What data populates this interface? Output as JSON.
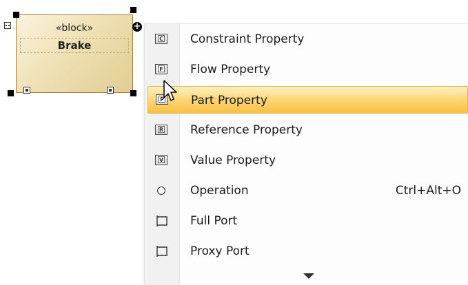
{
  "block": {
    "stereotype": "«block»",
    "name": "Brake"
  },
  "menu": {
    "items": [
      {
        "label": "Constraint Property",
        "icon": "constraint-property-icon",
        "icon_letter": "C",
        "shortcut": ""
      },
      {
        "label": "Flow Property",
        "icon": "flow-property-icon",
        "icon_letter": "F",
        "shortcut": ""
      },
      {
        "label": "Part Property",
        "icon": "part-property-icon",
        "icon_letter": "P",
        "shortcut": ""
      },
      {
        "label": "Reference Property",
        "icon": "reference-property-icon",
        "icon_letter": "R",
        "shortcut": ""
      },
      {
        "label": "Value Property",
        "icon": "value-property-icon",
        "icon_letter": "V",
        "shortcut": ""
      },
      {
        "label": "Operation",
        "icon": "operation-icon",
        "icon_letter": "",
        "shortcut": "Ctrl+Alt+O"
      },
      {
        "label": "Full Port",
        "icon": "full-port-icon",
        "icon_letter": "",
        "shortcut": ""
      },
      {
        "label": "Proxy Port",
        "icon": "proxy-port-icon",
        "icon_letter": "",
        "shortcut": ""
      }
    ],
    "highlighted_item": "Part Property",
    "more_indicator": "chevron-down-icon"
  },
  "colors": {
    "highlight": "#fcd46f",
    "block_fill": "#efe1b5",
    "block_border": "#a57a3c"
  }
}
